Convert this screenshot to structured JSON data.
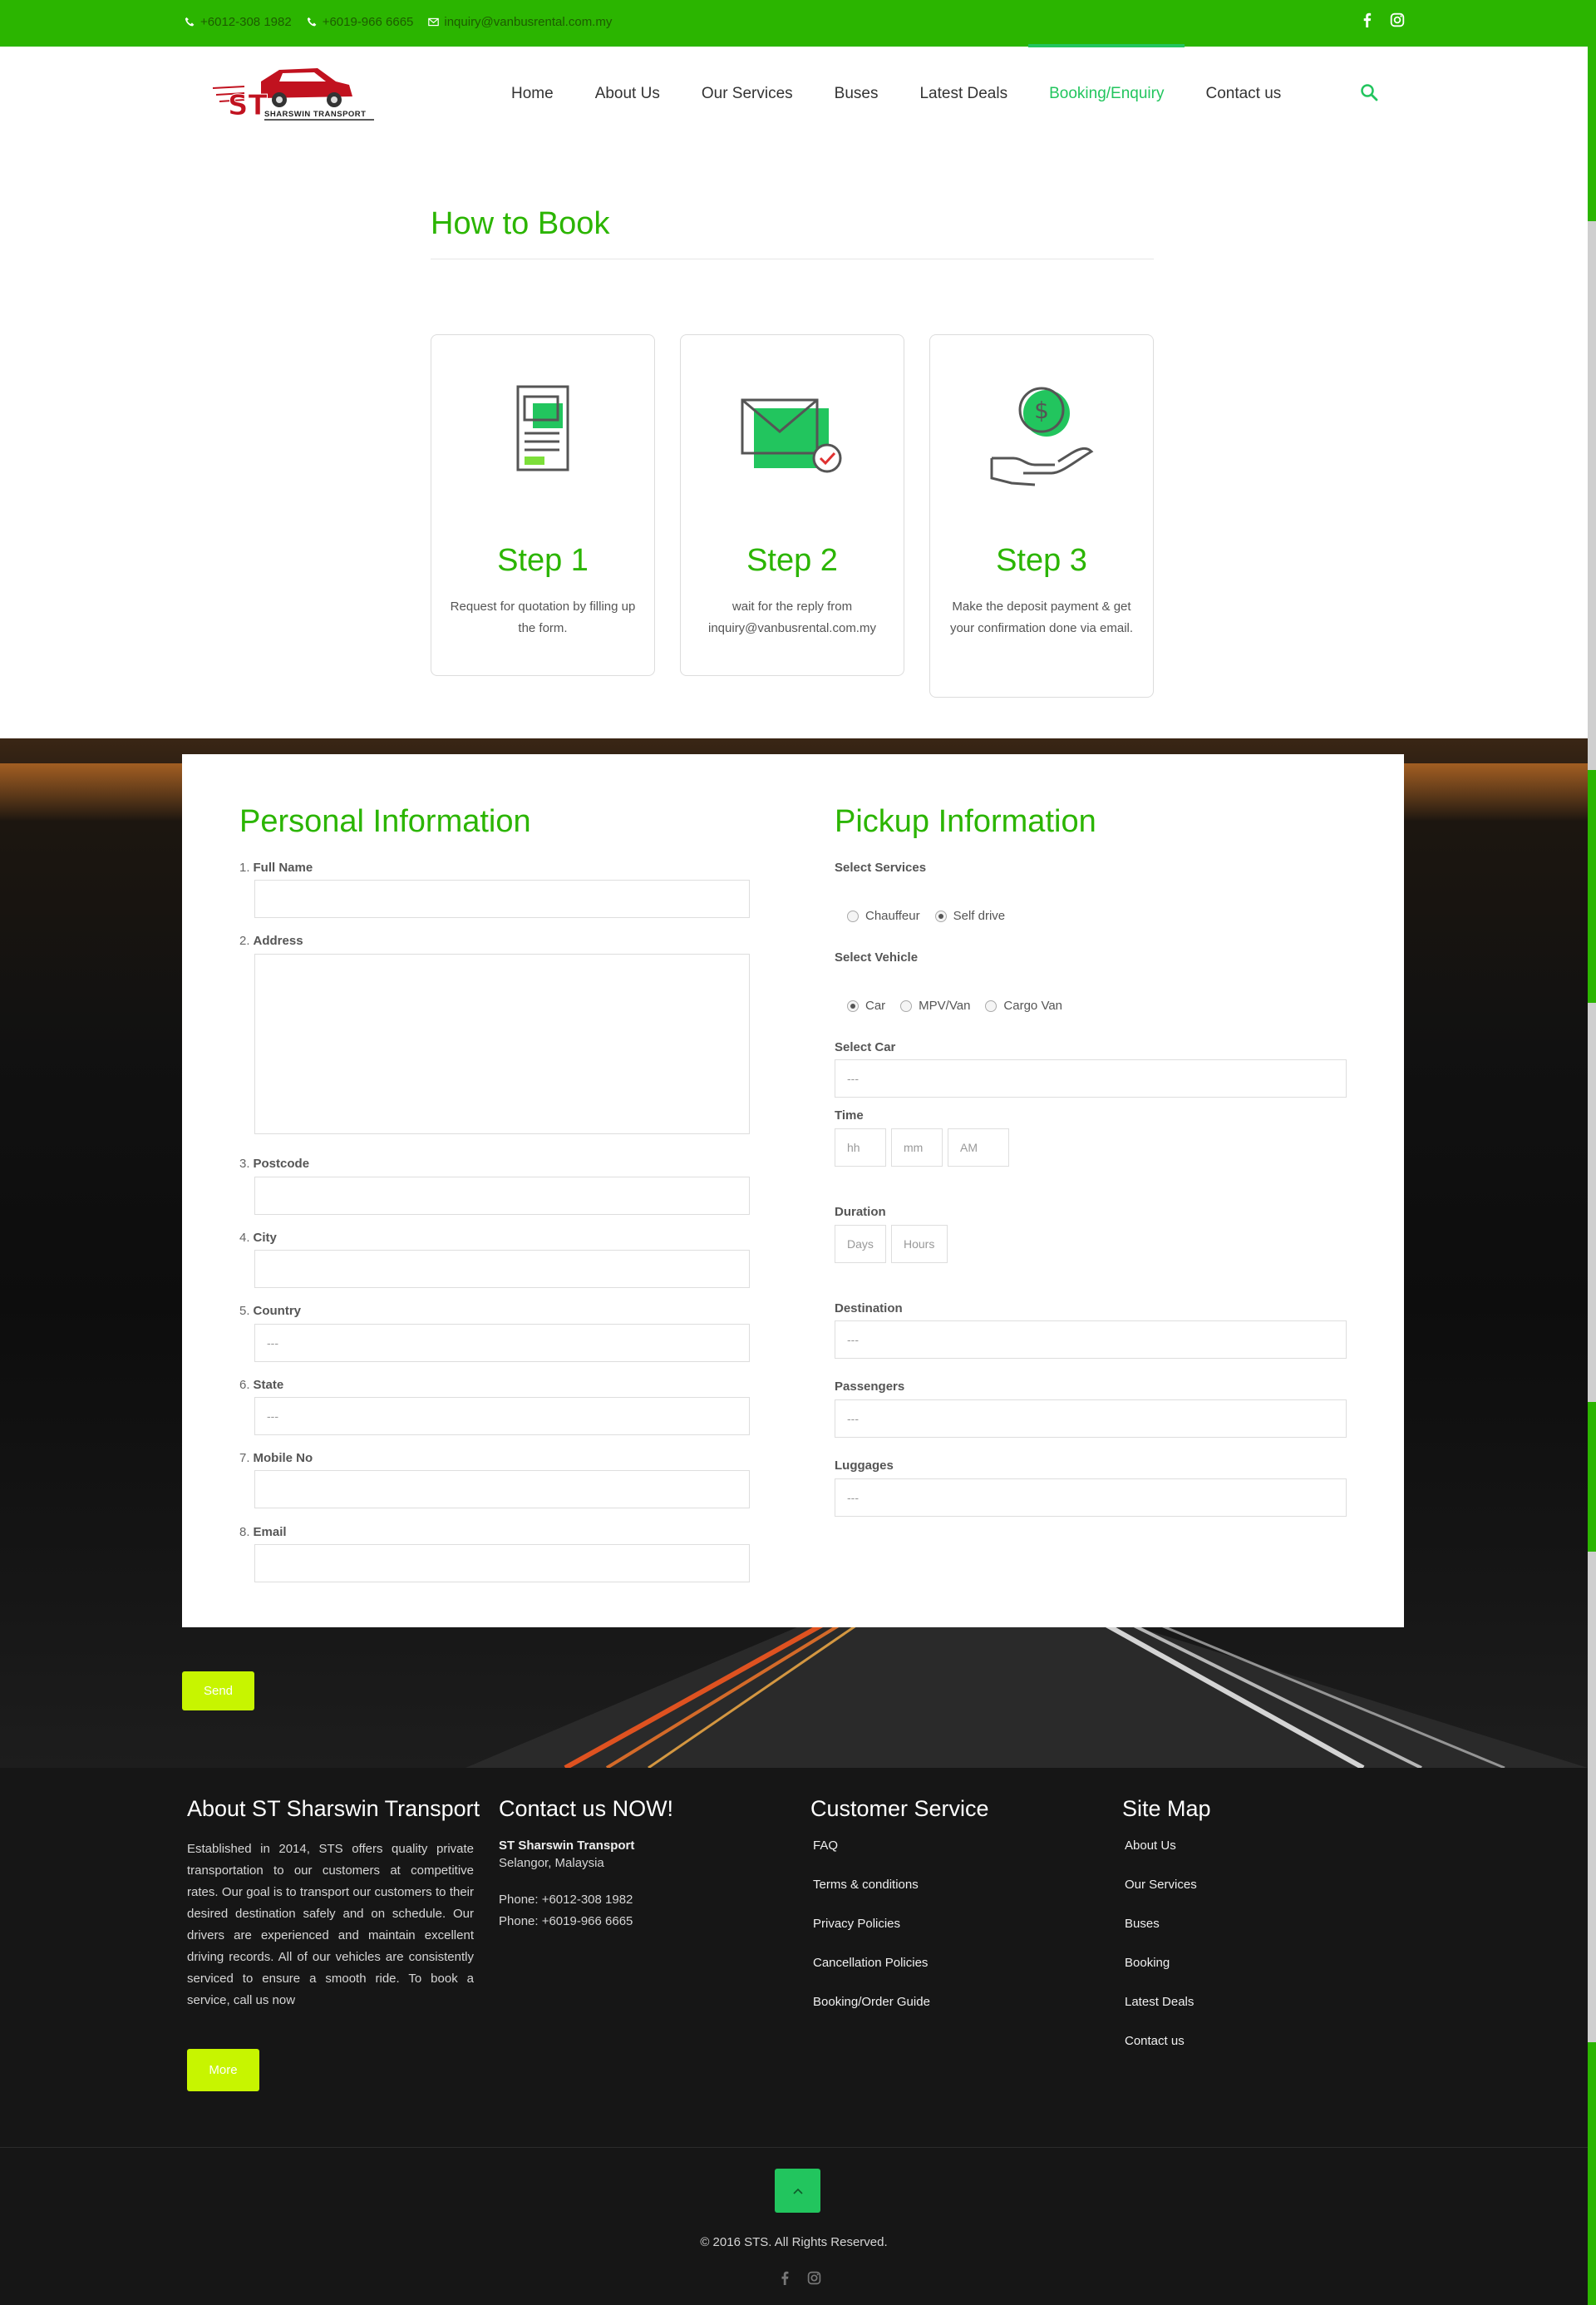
{
  "topbar": {
    "phone1": "+6012-308 1982",
    "phone2": "+6019-966 6665",
    "email": "inquiry@vanbusrental.com.my",
    "social": [
      "facebook-icon",
      "instagram-icon"
    ]
  },
  "logo": {
    "mark": "ST",
    "text": "Sharswin Transport"
  },
  "nav": {
    "items": [
      "Home",
      "About Us",
      "Our Services",
      "Buses",
      "Latest Deals",
      "Booking/Enquiry",
      "Contact us"
    ],
    "active": "Booking/Enquiry"
  },
  "how_to_book": {
    "title": "How to Book",
    "steps": [
      {
        "title": "Step 1",
        "desc": "Request for quotation by filling up the form.",
        "icon": "document-icon"
      },
      {
        "title": "Step 2",
        "desc": "wait for the reply from inquiry@vanbusrental.com.my",
        "icon": "envelope-check-icon"
      },
      {
        "title": "Step 3",
        "desc": "Make the deposit payment & get your confirmation done via email.",
        "icon": "payment-hand-icon"
      }
    ]
  },
  "personal": {
    "title": "Personal Information",
    "fields": [
      {
        "num": "1.",
        "label": "Full Name",
        "value": ""
      },
      {
        "num": "2.",
        "label": "Address",
        "value": ""
      },
      {
        "num": "3.",
        "label": "Postcode",
        "value": ""
      },
      {
        "num": "4.",
        "label": "City",
        "value": ""
      },
      {
        "num": "5.",
        "label": "Country",
        "value": "---"
      },
      {
        "num": "6.",
        "label": "State",
        "value": "---"
      },
      {
        "num": "7.",
        "label": "Mobile No",
        "value": ""
      },
      {
        "num": "8.",
        "label": "Email",
        "value": ""
      }
    ]
  },
  "pickup": {
    "title": "Pickup Information",
    "services_label": "Select Services",
    "services": [
      "Chauffeur",
      "Self drive"
    ],
    "service_selected": "Self drive",
    "vehicle_label": "Select Vehicle",
    "vehicles": [
      "Car",
      "MPV/Van",
      "Cargo Van"
    ],
    "vehicle_selected": "Car",
    "car_label": "Select Car",
    "car_value": "---",
    "time_label": "Time",
    "time_hh": "hh",
    "time_mm": "mm",
    "time_ampm": "AM",
    "duration_label": "Duration",
    "duration_days": "Days",
    "duration_hours": "Hours",
    "destination_label": "Destination",
    "destination_value": "---",
    "passengers_label": "Passengers",
    "passengers_value": "---",
    "luggages_label": "Luggages",
    "luggages_value": "---"
  },
  "send_label": "Send",
  "footer": {
    "about_title": "About ST Sharswin Transport",
    "about_text": "Established in 2014, STS offers quality private transportation to our customers at competitive rates. Our goal is to transport our customers to their desired destination safely and on schedule. Our drivers are experienced and maintain excellent driving records. All of our vehicles are consistently serviced to ensure a smooth ride. To book a service, call us now",
    "more_label": "More",
    "contact_title": "Contact us NOW!",
    "company": "ST Sharswin Transport",
    "location": "Selangor, Malaysia",
    "phone1": "Phone: +6012-308 1982",
    "phone2": "Phone: +6019-966 6665",
    "cs_title": "Customer Service",
    "cs_links": [
      "FAQ",
      "Terms & conditions",
      "Privacy Policies",
      "Cancellation Policies",
      "Booking/Order Guide"
    ],
    "sitemap_title": "Site Map",
    "sitemap_links": [
      "About Us",
      "Our Services",
      "Buses",
      "Booking",
      "Latest Deals",
      "Contact us"
    ],
    "copyright": "© 2016 STS. All Rights Reserved."
  },
  "colors": {
    "brand_green": "#2bb500",
    "accent_green": "#22c55e",
    "button_lime": "#c7f500",
    "footer_bg": "#161616"
  }
}
